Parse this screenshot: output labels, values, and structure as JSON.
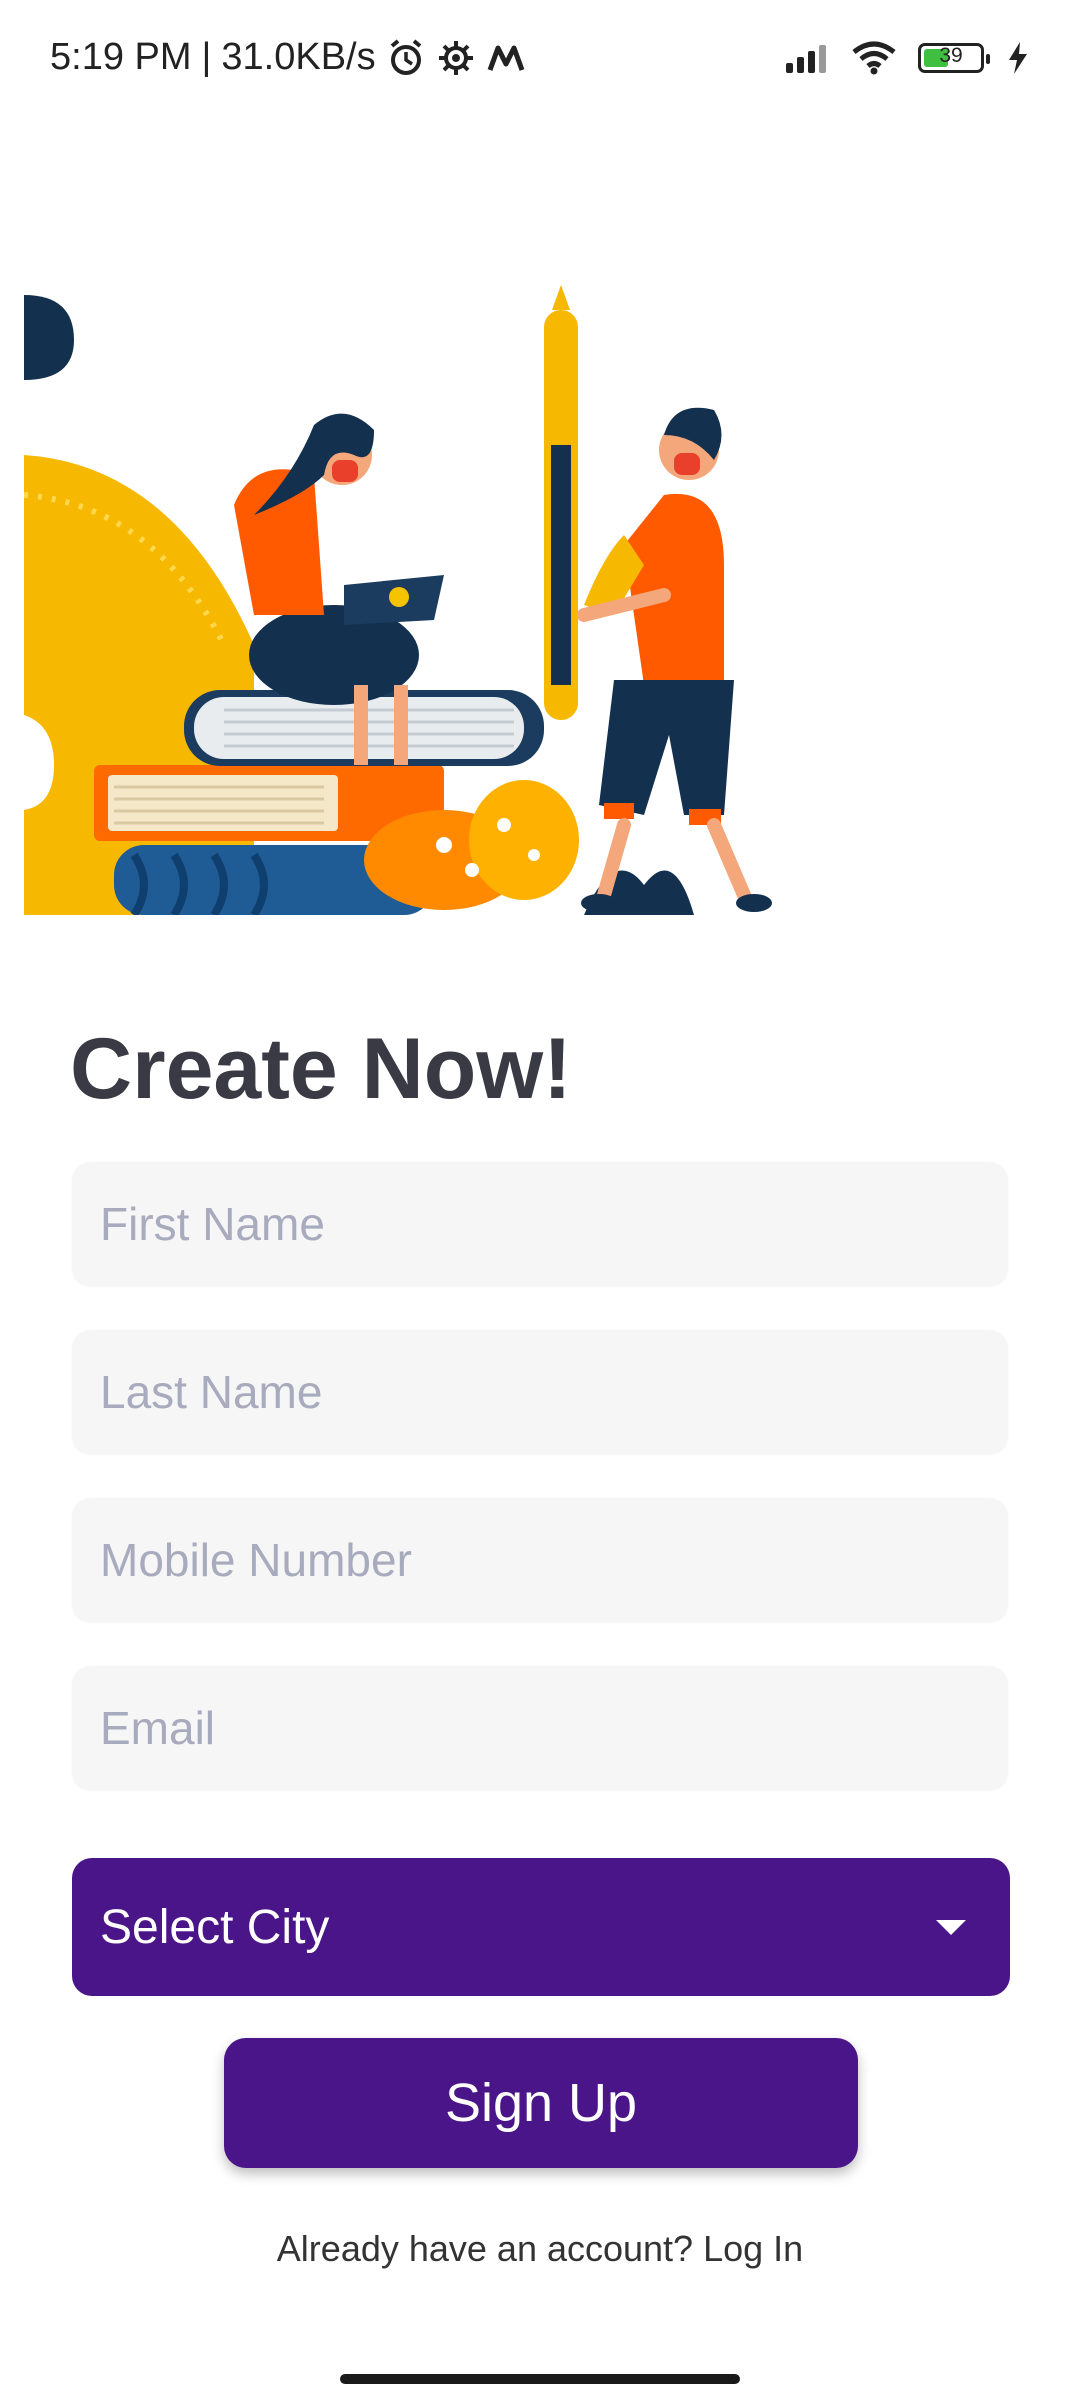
{
  "status_bar": {
    "time": "5:19 PM",
    "separator": "|",
    "speed": "31.0KB/s",
    "battery_level": "39",
    "icons": [
      "alarm-icon",
      "settings-icon",
      "m-app-icon",
      "signal-icon",
      "wifi-icon",
      "battery-icon",
      "charging-icon"
    ]
  },
  "form": {
    "title": "Create Now!",
    "first_name_placeholder": "First Name",
    "last_name_placeholder": "Last Name",
    "mobile_placeholder": "Mobile Number",
    "email_placeholder": "Email",
    "city_select_label": "Select City",
    "signup_label": "Sign Up",
    "login_prompt": "Already have an account?",
    "login_link": "Log In"
  },
  "colors": {
    "primary": "#4a1588",
    "field_bg": "#f6f6f7",
    "placeholder": "#a8abbd"
  }
}
